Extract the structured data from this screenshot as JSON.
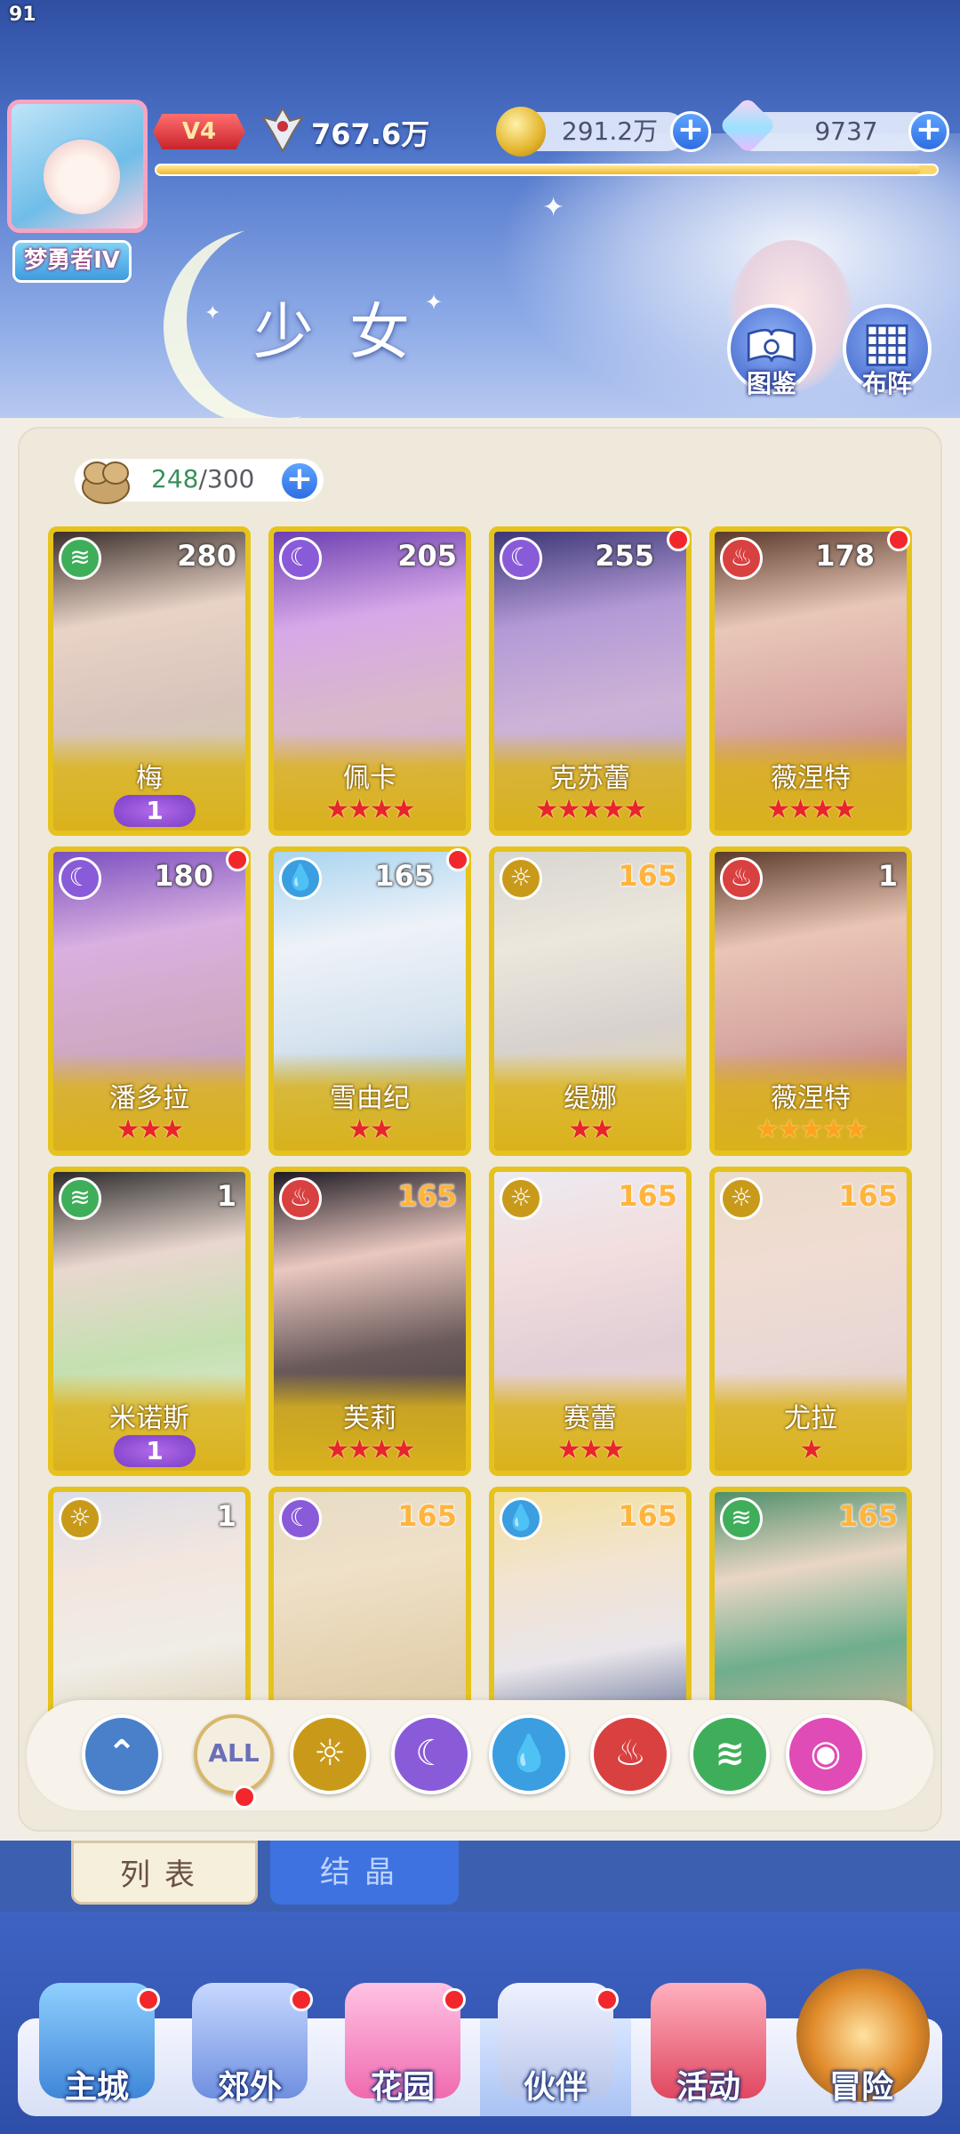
{
  "player": {
    "level": "91",
    "title": "梦勇者IV",
    "vip": "V4",
    "power": "767.6万",
    "xp_fraction": 0.98
  },
  "resources": {
    "coins": "291.2万",
    "gems": "9737",
    "plus": "+"
  },
  "page": {
    "title": "少女",
    "atlas_label": "图鉴",
    "formation_label": "布阵"
  },
  "capacity": {
    "current": "248",
    "separator": "/",
    "max": "300"
  },
  "elements": {
    "wind": {
      "color": "#3fae5a",
      "icon": "wind-icon"
    },
    "moon": {
      "color": "#8a5bd8",
      "icon": "moon-icon"
    },
    "fire": {
      "color": "#d94040",
      "icon": "flame-icon"
    },
    "water": {
      "color": "#3a9ee0",
      "icon": "droplet-icon"
    },
    "sun": {
      "color": "#c99a1a",
      "icon": "sun-icon"
    }
  },
  "cards": [
    {
      "name": "梅",
      "level": "280",
      "element": "wind",
      "badge": "1",
      "stars": 0,
      "star_color": "red",
      "dot": false
    },
    {
      "name": "佩卡",
      "level": "205",
      "element": "moon",
      "badge": "",
      "stars": 4,
      "star_color": "red",
      "dot": false
    },
    {
      "name": "克苏蕾",
      "level": "255",
      "element": "moon",
      "badge": "",
      "stars": 5,
      "star_color": "red",
      "dot": true
    },
    {
      "name": "薇涅特",
      "level": "178",
      "element": "fire",
      "badge": "",
      "stars": 4,
      "star_color": "red",
      "dot": true
    },
    {
      "name": "潘多拉",
      "level": "180",
      "element": "moon",
      "badge": "",
      "stars": 3,
      "star_color": "red",
      "dot": true
    },
    {
      "name": "雪由纪",
      "level": "165",
      "element": "water",
      "badge": "",
      "stars": 2,
      "star_color": "red",
      "dot": true
    },
    {
      "name": "缇娜",
      "level": "165",
      "element": "sun",
      "badge": "",
      "stars": 2,
      "star_color": "red",
      "dot": false
    },
    {
      "name": "薇涅特",
      "level": "1",
      "element": "fire",
      "badge": "",
      "stars": 5,
      "star_color": "gold",
      "dot": false
    },
    {
      "name": "米诺斯",
      "level": "1",
      "element": "wind",
      "badge": "1",
      "stars": 0,
      "star_color": "red",
      "dot": false
    },
    {
      "name": "芙莉",
      "level": "165",
      "element": "fire",
      "badge": "",
      "stars": 4,
      "star_color": "red",
      "dot": false
    },
    {
      "name": "赛蕾",
      "level": "165",
      "element": "sun",
      "badge": "",
      "stars": 3,
      "star_color": "red",
      "dot": false
    },
    {
      "name": "尤拉",
      "level": "165",
      "element": "sun",
      "badge": "",
      "stars": 1,
      "star_color": "red",
      "dot": false
    },
    {
      "name": "",
      "level": "1",
      "element": "sun",
      "badge": "",
      "stars": 0,
      "star_color": "red",
      "dot": false
    },
    {
      "name": "",
      "level": "165",
      "element": "moon",
      "badge": "",
      "stars": 0,
      "star_color": "red",
      "dot": false
    },
    {
      "name": "",
      "level": "165",
      "element": "water",
      "badge": "",
      "stars": 0,
      "star_color": "red",
      "dot": false
    },
    {
      "name": "",
      "level": "165",
      "element": "wind",
      "badge": "",
      "stars": 0,
      "star_color": "red",
      "dot": false
    }
  ],
  "filters": [
    {
      "key": "special",
      "label": "",
      "color": "#4a7fc9",
      "icon": "wings-icon"
    },
    {
      "key": "all",
      "label": "ALL",
      "color": "#f4eee0",
      "icon": "all-icon"
    },
    {
      "key": "sun",
      "label": "",
      "color": "#c99a1a",
      "icon": "sun-icon"
    },
    {
      "key": "moon",
      "label": "",
      "color": "#8a5bd8",
      "icon": "moon-icon"
    },
    {
      "key": "water",
      "label": "",
      "color": "#3a9ee0",
      "icon": "droplet-icon"
    },
    {
      "key": "fire",
      "label": "",
      "color": "#d94040",
      "icon": "flame-icon"
    },
    {
      "key": "wind",
      "label": "",
      "color": "#3fae5a",
      "icon": "wind-icon"
    },
    {
      "key": "love",
      "label": "",
      "color": "#e04bb5",
      "icon": "heart-orb-icon"
    }
  ],
  "tabs": {
    "list": "列表",
    "crystal": "结晶"
  },
  "nav": [
    {
      "label": "主城",
      "icon": "castle-icon",
      "dot": true
    },
    {
      "label": "郊外",
      "icon": "portal-icon",
      "dot": true
    },
    {
      "label": "花园",
      "icon": "heart-icon",
      "dot": true
    },
    {
      "label": "伙伴",
      "icon": "partner-icon",
      "dot": true
    },
    {
      "label": "活动",
      "icon": "gift-icon",
      "dot": false
    },
    {
      "label": "冒险",
      "icon": "compass-icon",
      "dot": false
    }
  ]
}
